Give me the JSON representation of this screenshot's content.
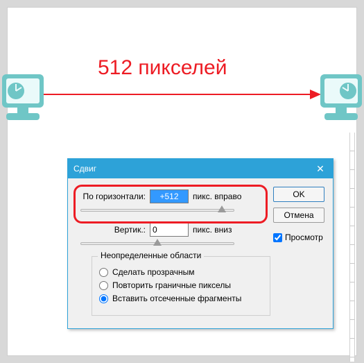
{
  "annotation": "512 пикселей",
  "dialog": {
    "title": "Сдвиг",
    "horizontal": {
      "label": "По горизонтали:",
      "value": "+512",
      "unit": "пикс. вправо"
    },
    "vertical": {
      "label": "Вертик.:",
      "value": "0",
      "unit": "пикс. вниз"
    },
    "undefined_areas": {
      "legend": "Неопределенные области",
      "options": [
        "Сделать прозрачным",
        "Повторить граничные пикселы",
        "Вставить отсеченные фрагменты"
      ],
      "selected_index": 2
    },
    "buttons": {
      "ok": "OK",
      "cancel": "Отмена"
    },
    "preview": {
      "label": "Просмотр",
      "checked": true
    }
  },
  "colors": {
    "accent": "#ed1c24",
    "titlebar": "#2da2d8",
    "teal": "#6fc6c6"
  }
}
